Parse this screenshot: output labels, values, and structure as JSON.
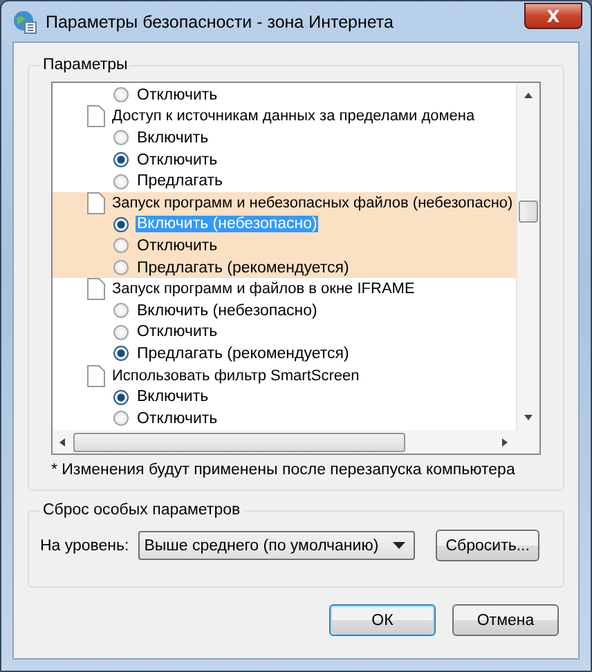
{
  "window": {
    "title": "Параметры безопасности - зона Интернета",
    "close": "X"
  },
  "settings": {
    "legend": "Параметры",
    "items": [
      {
        "kind": "radio",
        "label": "Отключить",
        "selected": false,
        "highlighted": false,
        "focused": false
      },
      {
        "kind": "group",
        "label": "Доступ к источникам данных за пределами домена",
        "highlighted": false
      },
      {
        "kind": "radio",
        "label": "Включить",
        "selected": false,
        "highlighted": false,
        "focused": false
      },
      {
        "kind": "radio",
        "label": "Отключить",
        "selected": true,
        "highlighted": false,
        "focused": false
      },
      {
        "kind": "radio",
        "label": "Предлагать",
        "selected": false,
        "highlighted": false,
        "focused": false
      },
      {
        "kind": "group",
        "label": "Запуск программ и небезопасных файлов (небезопасно)",
        "highlighted": true
      },
      {
        "kind": "radio",
        "label": "Включить (небезопасно)",
        "selected": true,
        "highlighted": true,
        "focused": true
      },
      {
        "kind": "radio",
        "label": "Отключить",
        "selected": false,
        "highlighted": true,
        "focused": false
      },
      {
        "kind": "radio",
        "label": "Предлагать (рекомендуется)",
        "selected": false,
        "highlighted": true,
        "focused": false
      },
      {
        "kind": "group",
        "label": "Запуск программ и файлов в окне IFRAME",
        "highlighted": false
      },
      {
        "kind": "radio",
        "label": "Включить (небезопасно)",
        "selected": false,
        "highlighted": false,
        "focused": false
      },
      {
        "kind": "radio",
        "label": "Отключить",
        "selected": false,
        "highlighted": false,
        "focused": false
      },
      {
        "kind": "radio",
        "label": "Предлагать (рекомендуется)",
        "selected": true,
        "highlighted": false,
        "focused": false
      },
      {
        "kind": "group",
        "label": "Использовать фильтр SmartScreen",
        "highlighted": false
      },
      {
        "kind": "radio",
        "label": "Включить",
        "selected": true,
        "highlighted": false,
        "focused": false
      },
      {
        "kind": "radio",
        "label": "Отключить",
        "selected": false,
        "highlighted": false,
        "focused": false
      }
    ],
    "note": "* Изменения будут применены после перезапуска компьютера"
  },
  "reset": {
    "legend": "Сброс особых параметров",
    "level_label": "На уровень:",
    "level_value": "Выше среднего (по умолчанию)",
    "button": "Сбросить..."
  },
  "buttons": [
    "ОК",
    "Отмена"
  ]
}
